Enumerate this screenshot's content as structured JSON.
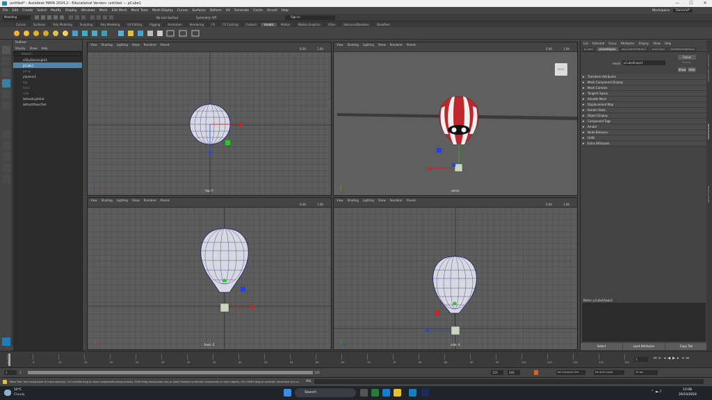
{
  "window": {
    "title": "untitled* - Autodesk MAYA 2024.2 - Educational Version: untitled --- pCube1",
    "controls": [
      "—",
      "☐",
      "✕"
    ]
  },
  "menubar": {
    "items": [
      "File",
      "Edit",
      "Create",
      "Select",
      "Modify",
      "Display",
      "Windows",
      "Mesh",
      "Edit Mesh",
      "Mesh Tools",
      "Mesh Display",
      "Curves",
      "Surfaces",
      "Deform",
      "UV",
      "Generate",
      "Cache",
      "Arnold",
      "Help"
    ],
    "workspace_label": "Workspace:",
    "workspace_value": "General*"
  },
  "statusline": {
    "mode": "Modeling",
    "live_surface": "No Live Surface",
    "symmetry": "Symmetry: Off",
    "sign_in": "Sign In"
  },
  "shelf": {
    "tabs": [
      "Curves",
      "Surfaces",
      "Poly Modeling",
      "Sculpting",
      "Poly Modeling",
      "UV Editing",
      "Rigging",
      "Animation",
      "Rendering",
      "FX",
      "FX Caching",
      "Custom",
      "Arnold",
      "Motion",
      "Motion Graphics",
      "XGen",
      "AdvancedSkeleton",
      "DeadPool"
    ],
    "active_tab": "Arnold"
  },
  "outliner": {
    "header": "Outliner",
    "menu": [
      "Display",
      "Show",
      "Help"
    ],
    "search_placeholder": "Search...",
    "items": [
      {
        "label": "aiSkyDomeLight1",
        "state": "normal"
      },
      {
        "label": "pCube1",
        "state": "selected"
      },
      {
        "label": "persp",
        "state": "dim"
      },
      {
        "label": "pSphere1",
        "state": "normal"
      },
      {
        "label": "top",
        "state": "dim"
      },
      {
        "label": "front",
        "state": "dim"
      },
      {
        "label": "side",
        "state": "dim"
      },
      {
        "label": "defaultLightSet",
        "state": "set"
      },
      {
        "label": "defaultObjectSet",
        "state": "set"
      }
    ]
  },
  "viewports": [
    {
      "id": "top",
      "camera": "top -Y",
      "menu": [
        "View",
        "Shading",
        "Lighting",
        "Show",
        "Renderer",
        "Panels"
      ],
      "value_a": "0.00",
      "value_b": "1.00"
    },
    {
      "id": "persp",
      "camera": "persp",
      "menu": [
        "View",
        "Shading",
        "Lighting",
        "Show",
        "Renderer",
        "Panels"
      ],
      "value_a": "0.00",
      "value_b": "1.00",
      "viewcube": "BACK"
    },
    {
      "id": "front",
      "camera": "front -Z",
      "menu": [
        "View",
        "Shading",
        "Lighting",
        "Show",
        "Renderer",
        "Panels"
      ],
      "value_a": "0.00",
      "value_b": "1.00"
    },
    {
      "id": "side",
      "camera": "side -X",
      "menu": [
        "View",
        "Shading",
        "Lighting",
        "Show",
        "Renderer",
        "Panels"
      ],
      "value_a": "0.00",
      "value_b": "1.00"
    }
  ],
  "attribute_editor": {
    "menu": [
      "List",
      "Selected",
      "Focus",
      "Attributes",
      "Display",
      "Show",
      "Help"
    ],
    "tabs": [
      "pCube1",
      "pCubeShape1",
      "polyColorPerVertex1",
      "polyCube1",
      "initialShadingGroup"
    ],
    "active_tab": "pCubeShape1",
    "mesh_label": "mesh:",
    "mesh_value": "pCubeShape1",
    "buttons": [
      "Focus",
      "Presets",
      "Show",
      "Hide"
    ],
    "sections": [
      "Transform Attributes",
      "Mesh Component Display",
      "Mesh Controls",
      "Tangent Space",
      "Smooth Mesh",
      "Displacement Map",
      "Render Stats",
      "Object Display",
      "Component Tags",
      "Arnold",
      "Node Behavior",
      "UUID",
      "Extra Attributes"
    ],
    "notes_label": "Notes: pCubeShape1",
    "bottom_buttons": [
      "Select",
      "Load Attributes",
      "Copy Tab"
    ]
  },
  "right_strip_tabs": [
    "Channel Box / Layer Editor",
    "Attribute Editor",
    "Modeling Toolkit"
  ],
  "timeline": {
    "ticks": [
      "1",
      "5",
      "10",
      "15",
      "20",
      "25",
      "30",
      "35",
      "40",
      "45",
      "50",
      "55",
      "60",
      "65",
      "70",
      "75",
      "80",
      "85",
      "90",
      "95",
      "100",
      "105",
      "110",
      "115",
      "120"
    ],
    "current_frame": "1",
    "start": "1",
    "range_start": "1",
    "range_end": "120",
    "anim_end": "120",
    "max": "200",
    "character_set": "No Character Set",
    "anim_layer": "No Anim Layer",
    "fps": "24 fps"
  },
  "helpline": {
    "text": "Move Tool: Use manipulator to move object(s). Ctrl+middle drag to move components along normals. Shift+drag manipulator axis or plane handles to extrude components or clone objects. Ctrl+Shift+drag to constrain movement to a co",
    "mel_label": "MEL"
  },
  "taskbar": {
    "weather_temp": "10°C",
    "weather_text": "Cloudy",
    "search_placeholder": "Search",
    "time": "13:08",
    "date": "26/10/2024"
  },
  "colors": {
    "accent": "#5285a6",
    "maya_blue": "#1a8fa8",
    "balloon_red": "#c0272d",
    "manip_red": "#d62020",
    "manip_green": "#22cc22",
    "manip_blue": "#2244dd"
  }
}
